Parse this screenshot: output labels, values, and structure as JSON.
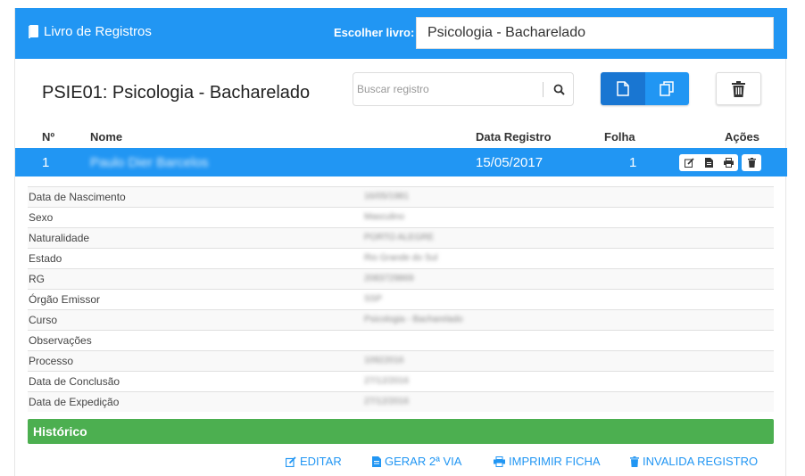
{
  "topbar": {
    "brand": "Livro de Registros",
    "choose_label": "Escolher livro:",
    "selected_book": "Psicologia - Bacharelado"
  },
  "page": {
    "title": "PSIE01: Psicologia - Bacharelado"
  },
  "search": {
    "placeholder": "Buscar registro",
    "value": ""
  },
  "table": {
    "headers": {
      "number": "Nº",
      "name": "Nome",
      "date": "Data Registro",
      "page": "Folha",
      "actions": "Ações"
    },
    "selected_row": {
      "number": "1",
      "name": "Paulo Dier Barcelos",
      "date": "15/05/2017",
      "page": "1"
    }
  },
  "details": [
    {
      "label": "Data de Nascimento",
      "value": "16/05/1981"
    },
    {
      "label": "Sexo",
      "value": "Masculino"
    },
    {
      "label": "Naturalidade",
      "value": "PORTO ALEGRE"
    },
    {
      "label": "Estado",
      "value": "Rio Grande do Sul"
    },
    {
      "label": "RG",
      "value": "2083729869"
    },
    {
      "label": "Órgão Emissor",
      "value": "SSP"
    },
    {
      "label": "Curso",
      "value": "Psicologia - Bacharelado"
    },
    {
      "label": "Observações",
      "value": ""
    },
    {
      "label": "Processo",
      "value": "10922016"
    },
    {
      "label": "Data de Conclusão",
      "value": "27/12/2016"
    },
    {
      "label": "Data de Expedição",
      "value": "27/12/2016"
    }
  ],
  "historico": {
    "label": "Histórico"
  },
  "actions": {
    "edit": "EDITAR",
    "second_copy": "GERAR 2ª VIA",
    "print": "IMPRIMIR FICHA",
    "invalidate": "INVALIDA REGISTRO"
  },
  "colors": {
    "primary": "#2196f3",
    "primary_dark": "#1976d2",
    "success": "#4caf50"
  },
  "icons": {
    "brand": "book-icon",
    "search": "search-icon",
    "new": "file-icon",
    "copy": "copy-icon",
    "delete": "trash-icon",
    "edit": "edit-icon",
    "document": "document-icon",
    "print": "print-icon"
  }
}
